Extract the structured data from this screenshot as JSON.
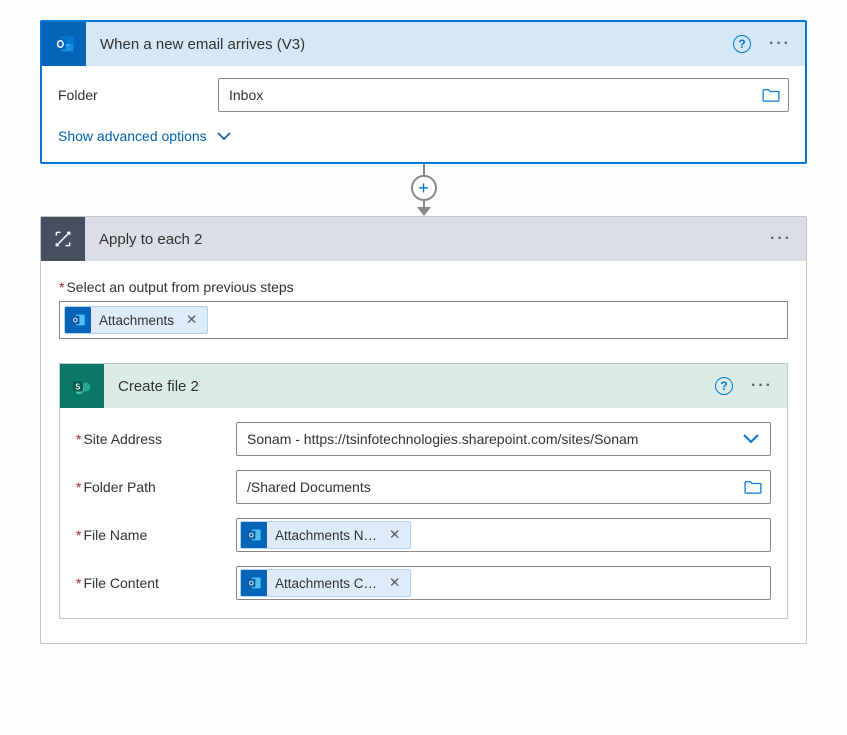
{
  "trigger": {
    "title": "When a new email arrives (V3)",
    "folder_label": "Folder",
    "folder_value": "Inbox",
    "advanced": "Show advanced options"
  },
  "each": {
    "title": "Apply to each 2",
    "select_label": "Select an output from previous steps",
    "token": "Attachments"
  },
  "createfile": {
    "title": "Create file 2",
    "site_label": "Site Address",
    "site_value": "Sonam - https://tsinfotechnologies.sharepoint.com/sites/Sonam",
    "folder_label": "Folder Path",
    "folder_value": "/Shared Documents",
    "filename_label": "File Name",
    "filename_token": "Attachments N…",
    "filecontent_label": "File Content",
    "filecontent_token": "Attachments C…"
  }
}
